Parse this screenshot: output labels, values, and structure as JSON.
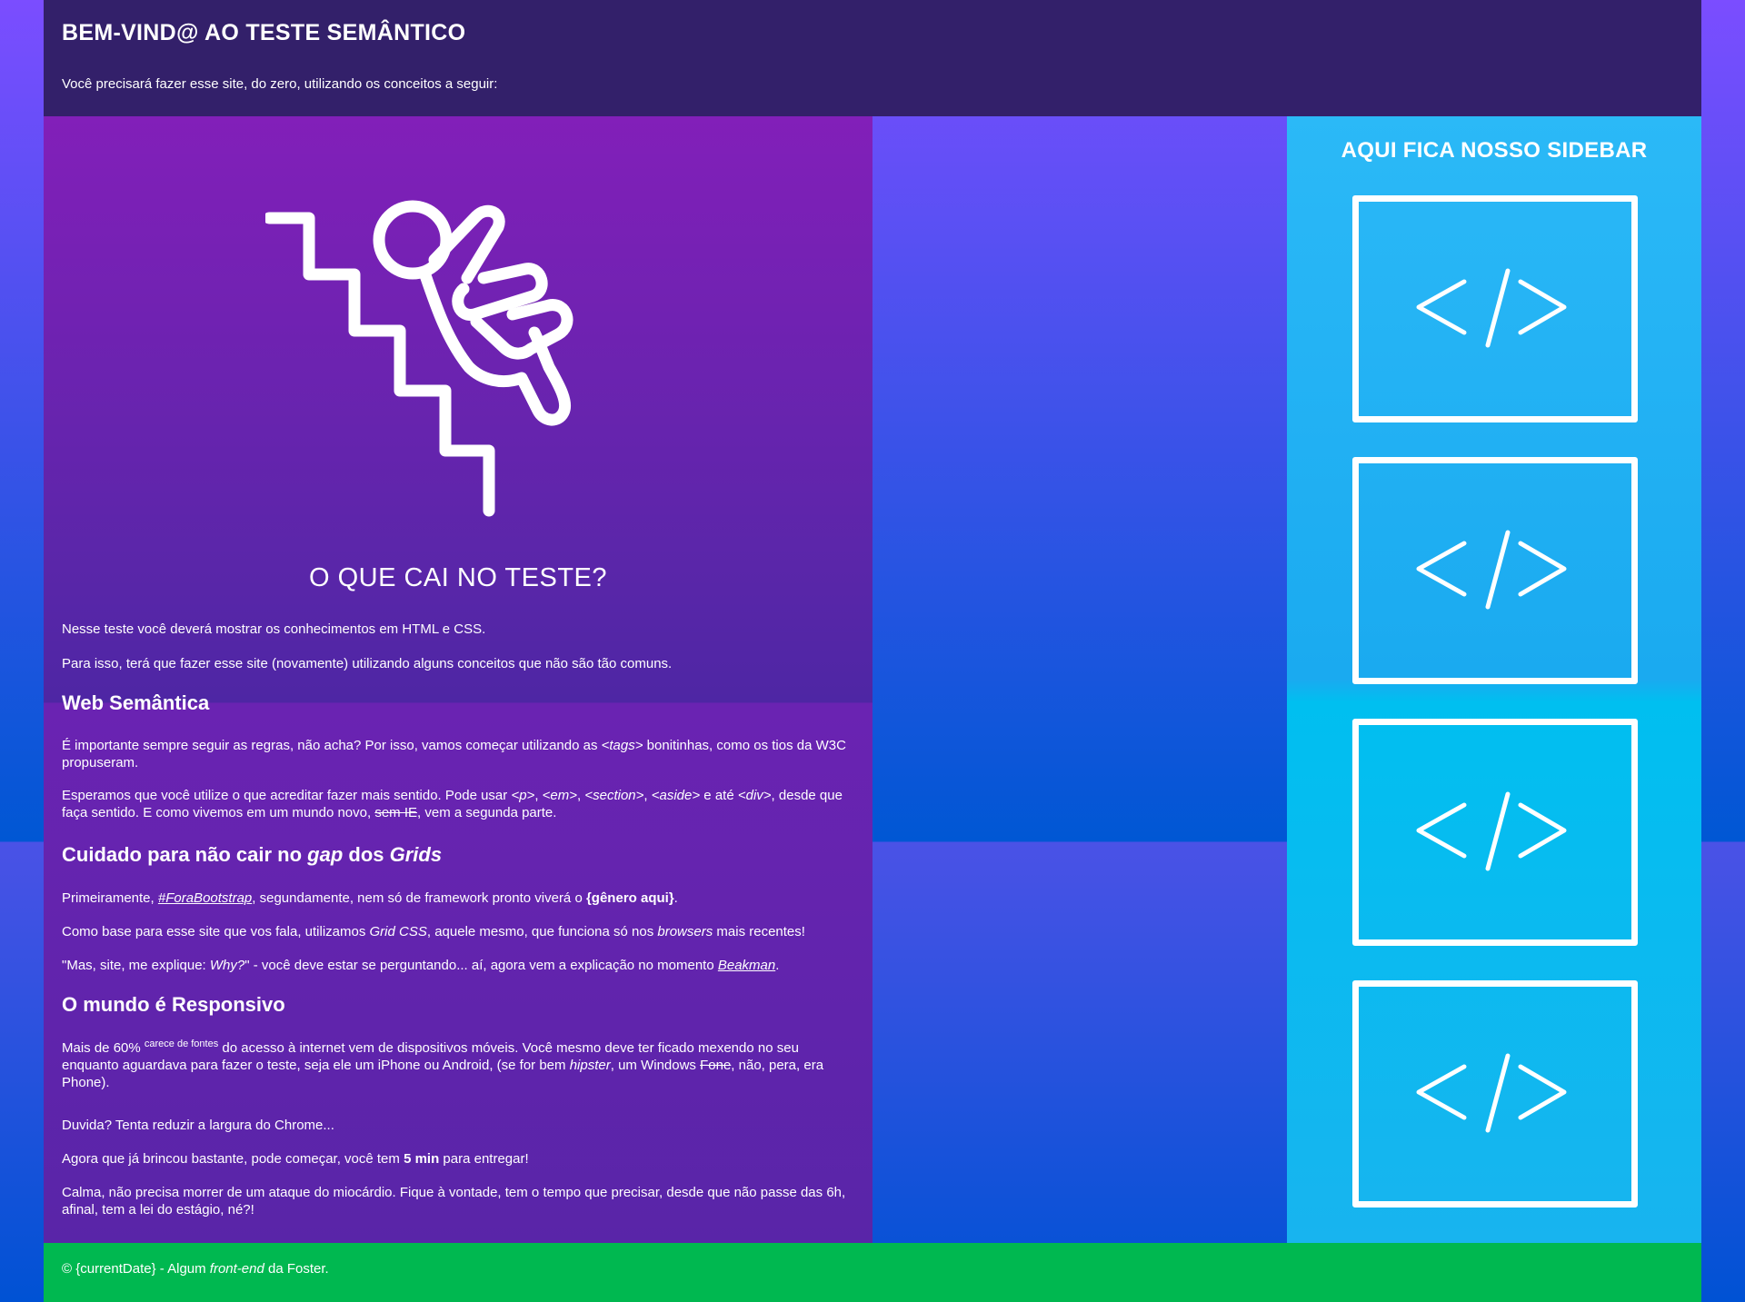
{
  "header": {
    "title": "BEM-VIND@ AO TESTE SEMÂNTICO",
    "subtitle": "Você precisará fazer esse site, do zero, utilizando os conceitos a seguir:"
  },
  "main": {
    "icon": "person-falling-down-stairs-icon",
    "heading": "O QUE CAI NO TESTE?",
    "intro_1": "Nesse teste você deverá mostrar os conhecimentos em HTML e CSS.",
    "intro_2": "Para isso, terá que fazer esse site (novamente) utilizando alguns conceitos que não são tão comuns.",
    "web_semantica": {
      "title": "Web Semântica",
      "p1": {
        "a": "É importante sempre seguir as regras, não acha? Por isso, vamos começar utilizando as ",
        "tags": "<tags>",
        "b": " bonitinhas, como os tios da W3C propuseram."
      },
      "p2": {
        "a": "Esperamos que você utilize o que acreditar fazer mais sentido. Pode usar ",
        "t1": "<p>",
        "s1": ", ",
        "t2": "<em>",
        "s2": ", ",
        "t3": "<section>",
        "s3": ", ",
        "t4": "<aside>",
        "s4": " e até ",
        "t5": "<div>",
        "b": ", desde que faça sentido. E como vivemos em um mundo novo, ",
        "strike": "sem IE",
        "c": ", vem a segunda parte."
      }
    },
    "grids": {
      "title_a": "Cuidado para não cair no ",
      "title_gap": "gap",
      "title_b": " dos ",
      "title_grids": "Grids",
      "p1": {
        "a": "Primeiramente, ",
        "link": "#ForaBootstrap",
        "b": ", segundamente, nem só de framework pronto viverá o ",
        "bold": "{gênero aqui}",
        "c": "."
      },
      "p2": {
        "a": "Como base para esse site que vos fala, utilizamos ",
        "em1": "Grid CSS",
        "b": ", aquele mesmo, que funciona só nos ",
        "em2": "browsers",
        "c": " mais recentes!"
      },
      "p3": {
        "a": "\"Mas, site, me explique: ",
        "em": "Why?",
        "b": "\" - você deve estar se perguntando... aí, agora vem a explicação no momento ",
        "link": "Beakman",
        "c": "."
      }
    },
    "responsivo": {
      "title_a": "O mundo é ",
      "title_bold": "Responsivo",
      "p1": {
        "a": "Mais de 60% ",
        "sup": "carece de fontes",
        "b": " do acesso à internet vem de dispositivos móveis. Você mesmo deve ter ficado mexendo no seu enquanto aguardava para fazer o teste, seja ele um iPhone ou Android, (se for bem ",
        "em": "hipster",
        "c": ", um Windows ",
        "strike": "Fone",
        "d": ", não, pera, era Phone)."
      },
      "p2": "Duvida? Tenta reduzir a largura do Chrome...",
      "p3": {
        "a": "Agora que já brincou bastante, pode começar, você tem ",
        "bold": "5 min",
        "b": " para entregar!"
      },
      "p4": "Calma, não precisa morrer de um ataque do miocárdio. Fique à vontade, tem o tempo que precisar, desde que não passe das 6h, afinal, tem a lei do estágio, né?!"
    }
  },
  "sidebar": {
    "title": "AQUI FICA NOSSO SIDEBAR",
    "cards": [
      {
        "icon": "code-icon"
      },
      {
        "icon": "code-icon"
      },
      {
        "icon": "code-icon"
      },
      {
        "icon": "code-icon"
      }
    ]
  },
  "footer": {
    "a": "© {currentDate} - Algum ",
    "em": "front-end",
    "b": " da Foster."
  },
  "colors": {
    "header_bg": "#33206a",
    "main_bg": "#6a23b2",
    "sidebar_bg": "#1ab3f2",
    "footer_bg": "#00b850",
    "page_bg_top": "#7b4dff",
    "page_bg_bottom": "#0057d4"
  }
}
